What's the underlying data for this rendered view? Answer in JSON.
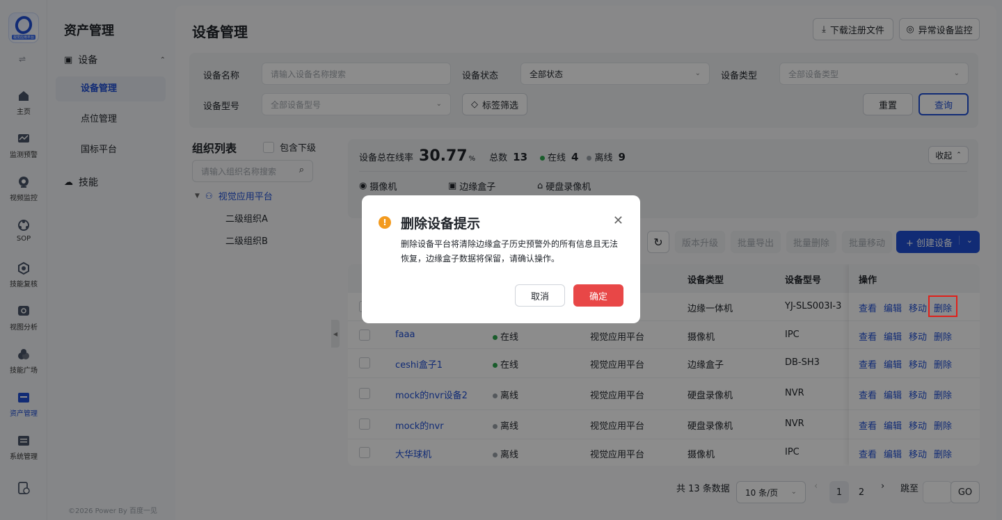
{
  "rail": {
    "logo_text": "视觉应用平台",
    "items": [
      {
        "label": "主页",
        "icon": "home-icon"
      },
      {
        "label": "监测预警",
        "icon": "monitor-icon"
      },
      {
        "label": "视频监控",
        "icon": "camera-icon"
      },
      {
        "label": "SOP",
        "icon": "sop-icon"
      },
      {
        "label": "技能复核",
        "icon": "review-icon"
      },
      {
        "label": "视图分析",
        "icon": "analysis-icon"
      },
      {
        "label": "技能广场",
        "icon": "plaza-icon"
      },
      {
        "label": "资产管理",
        "icon": "asset-icon",
        "active": true
      },
      {
        "label": "系统管理",
        "icon": "system-icon"
      }
    ]
  },
  "nav": {
    "title": "资产管理",
    "group_device": "设备",
    "sub_items": [
      "设备管理",
      "点位管理",
      "国标平台"
    ],
    "group_skill": "技能",
    "footer": "©2026 Power By 百度一见"
  },
  "header": {
    "title": "设备管理",
    "download_label": "下载注册文件",
    "monitor_label": "异常设备监控"
  },
  "filters": {
    "name_label": "设备名称",
    "name_placeholder": "请输入设备名称搜索",
    "status_label": "设备状态",
    "status_value": "全部状态",
    "type_label": "设备类型",
    "type_placeholder": "全部设备类型",
    "model_label": "设备型号",
    "model_placeholder": "全部设备型号",
    "tag_filter": "标签筛选",
    "reset": "重置",
    "query": "查询"
  },
  "org": {
    "title": "组织列表",
    "include_sub": "包含下级",
    "search_placeholder": "请输入组织名称搜索",
    "root": "视觉应用平台",
    "children": [
      "二级组织A",
      "二级组织B"
    ]
  },
  "stats": {
    "online_rate_label": "设备总在线率",
    "online_rate_value": "30.77",
    "online_rate_unit": "%",
    "total_label": "总数",
    "total_value": "13",
    "online_label": "在线",
    "online_value": "4",
    "offline_label": "离线",
    "offline_value": "9",
    "collapse": "收起",
    "types": [
      "摄像机",
      "边缘盒子",
      "硬盘录像机"
    ]
  },
  "toolbar": {
    "upgrade": "版本升级",
    "export": "批量导出",
    "delete": "批量删除",
    "move": "批量移动",
    "create": "+ 创建设备"
  },
  "table": {
    "headers": {
      "type": "设备类型",
      "model": "设备型号",
      "ops": "操作"
    },
    "ops": [
      "查看",
      "编辑",
      "移动",
      "删除"
    ],
    "first_row": {
      "type": "边缘一体机",
      "model": "YJ-SLS003I-3"
    },
    "rows": [
      {
        "name": "faaa",
        "status": "在线",
        "org": "视觉应用平台",
        "type": "摄像机",
        "model": "IPC"
      },
      {
        "name": "ceshi盒子1",
        "status": "在线",
        "org": "视觉应用平台",
        "type": "边缘盒子",
        "model": "DB-SH3"
      },
      {
        "name": "mock的nvr设备2",
        "status": "离线",
        "org": "视觉应用平台",
        "type": "硬盘录像机",
        "model": "NVR"
      },
      {
        "name": "mock的nvr",
        "status": "离线",
        "org": "视觉应用平台",
        "type": "硬盘录像机",
        "model": "NVR"
      },
      {
        "name": "大华球机",
        "status": "离线",
        "org": "视觉应用平台",
        "type": "摄像机",
        "model": "IPC"
      }
    ]
  },
  "pager": {
    "total": "共 13 条数据",
    "page_size": "10 条/页",
    "pages": [
      "1",
      "2"
    ],
    "jump_label": "跳至",
    "go": "GO"
  },
  "modal": {
    "title": "删除设备提示",
    "body": "删除设备平台将清除边缘盒子历史预警外的所有信息且无法恢复，边缘盒子数据将保留，请确认操作。",
    "cancel": "取消",
    "confirm": "确定"
  },
  "colors": {
    "accent": "#1f4fd6",
    "online": "#2fa84f",
    "offline": "#9aa0a8",
    "danger": "#e84747",
    "warning": "#f39a1e"
  }
}
